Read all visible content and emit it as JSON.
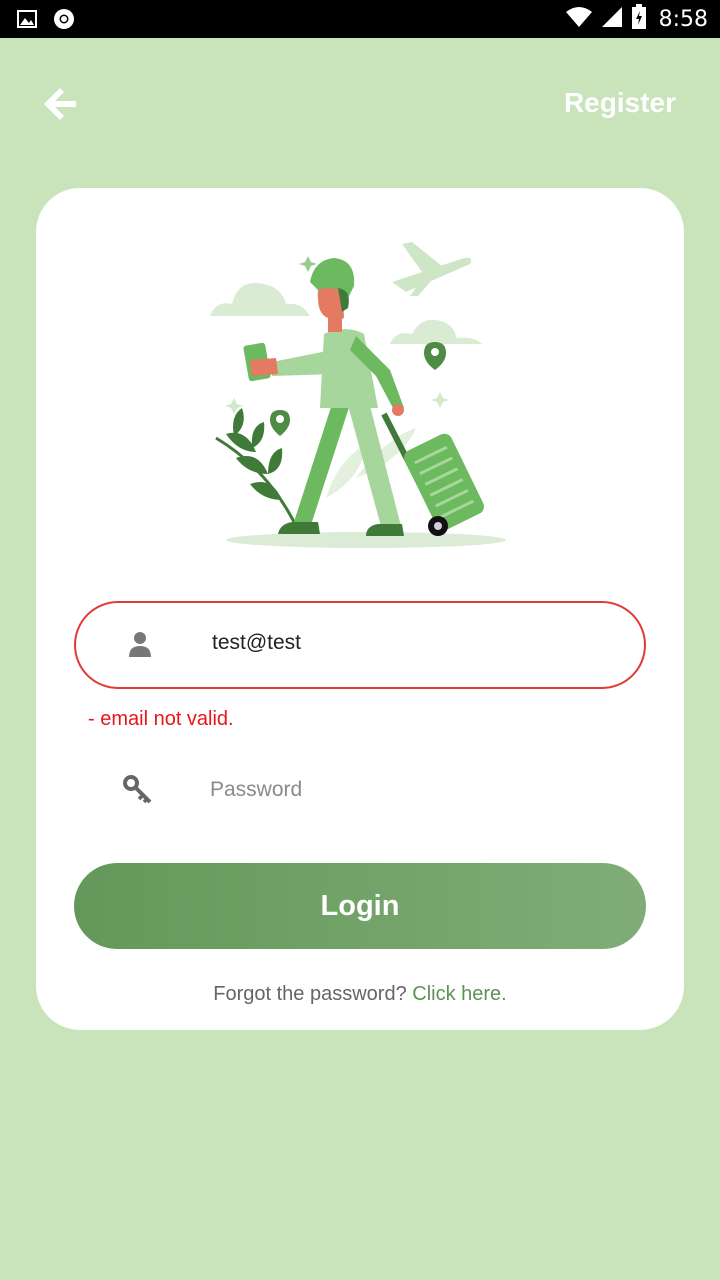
{
  "status_bar": {
    "time": "8:58",
    "left_icons": [
      "image-icon",
      "chrome-icon"
    ],
    "right_icons": [
      "wifi-icon",
      "cell-signal-icon",
      "battery-charging-icon"
    ]
  },
  "app_bar": {
    "back_icon": "arrow-left-icon",
    "register_label": "Register"
  },
  "form": {
    "email_icon": "user-icon",
    "email_value": "test@test",
    "email_error": "- email not valid.",
    "password_icon": "key-icon",
    "password_placeholder": "Password",
    "login_label": "Login",
    "forgot_text": "Forgot the password?",
    "forgot_link": "Click here."
  },
  "colors": {
    "background": "#c9e4bb",
    "card": "#ffffff",
    "accent": "#64985a",
    "error": "#e53935"
  }
}
